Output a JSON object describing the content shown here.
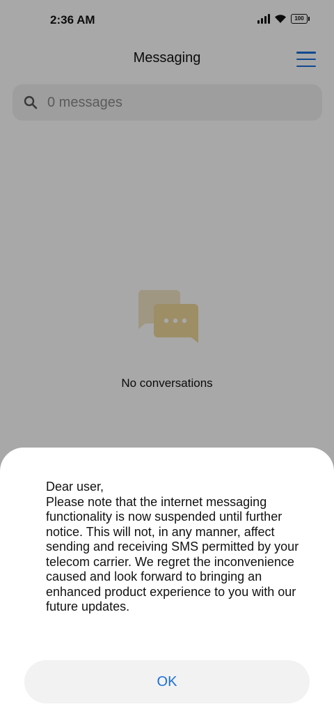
{
  "status_bar": {
    "time": "2:36 AM",
    "battery": "100"
  },
  "header": {
    "title": "Messaging",
    "menu_icon": "hamburger-menu-icon"
  },
  "search": {
    "icon": "search-icon",
    "placeholder": "0 messages"
  },
  "empty_state": {
    "illustration": "chat-bubbles-icon",
    "message": "No conversations"
  },
  "dialog": {
    "message": "Dear user,\nPlease note that the internet messaging functionality is now suspended until further notice. This will not, in any manner, affect sending and receiving SMS permitted by your telecom carrier. We regret the inconvenience caused and look forward to bringing an enhanced product experience to you with our future updates.",
    "ok_label": "OK"
  },
  "colors": {
    "accent": "#1a6fd6",
    "scrim": "#000000",
    "illustration_back": "#f3e6c6",
    "illustration_front": "#efd89c"
  }
}
